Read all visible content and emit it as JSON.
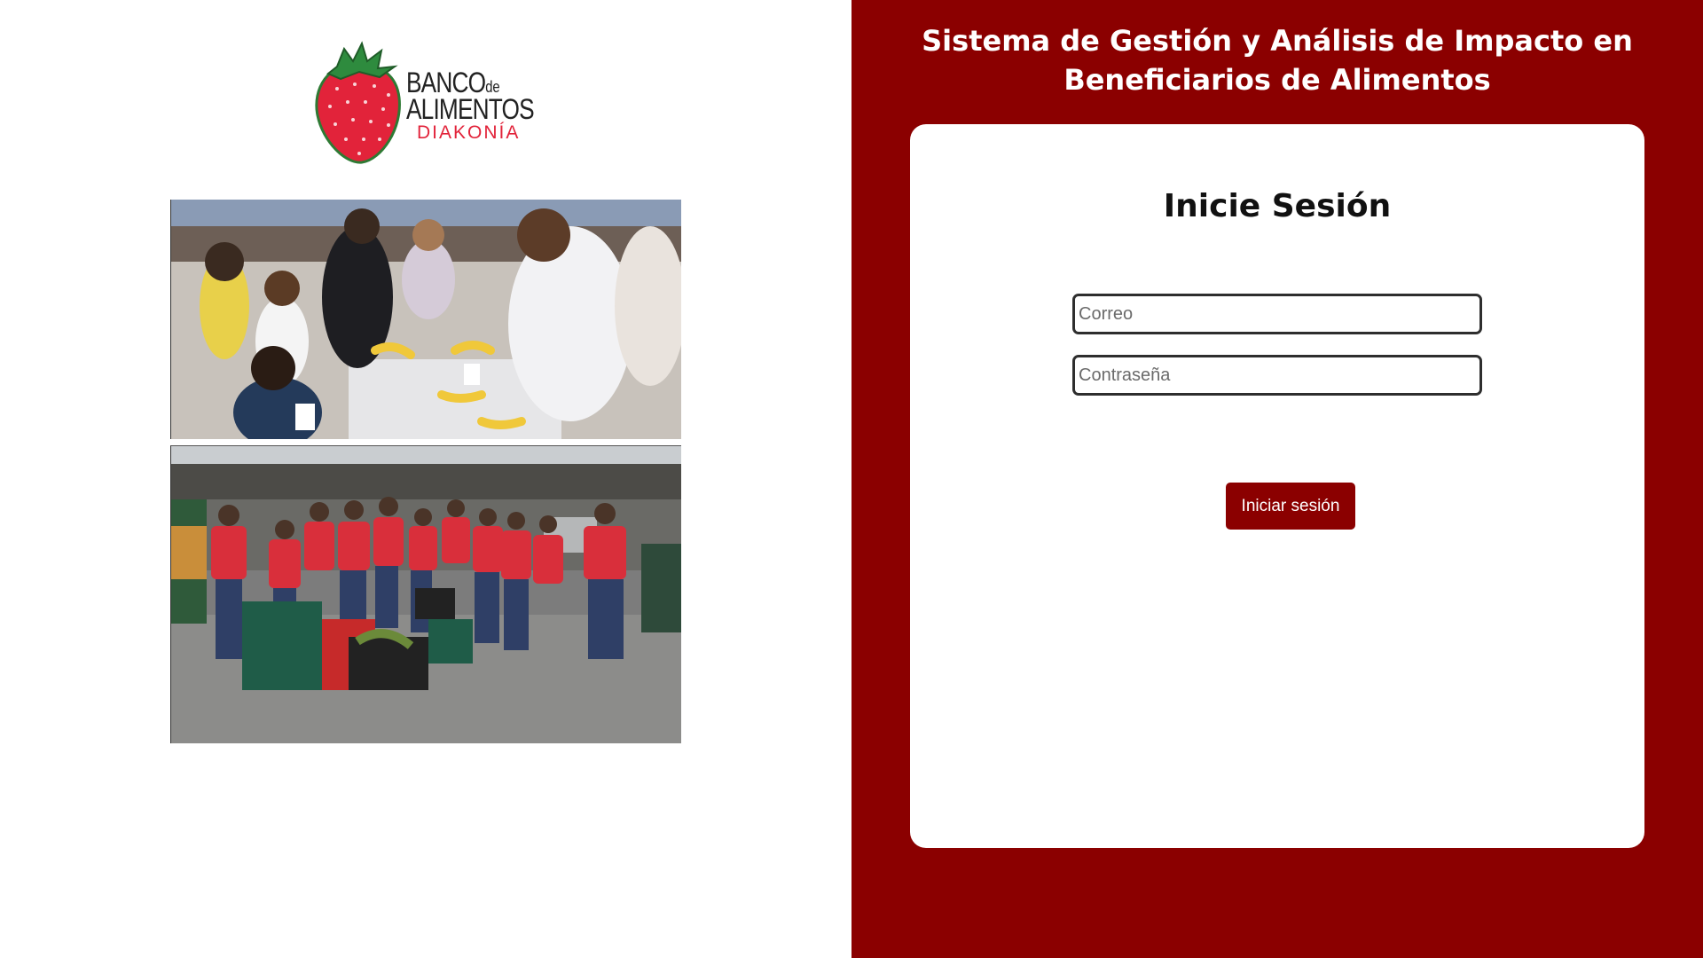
{
  "brand": {
    "logo_line1": "BANCO",
    "logo_line1_small": "de",
    "logo_line2": "ALIMENTOS",
    "logo_line3": "DIAKONÍA",
    "strawberry_color": "#e2233a",
    "leaf_color": "#2e8b3e"
  },
  "header": {
    "title": "Sistema de Gestión y Análisis de Impacto en Beneficiarios de Alimentos"
  },
  "login": {
    "title": "Inicie Sesión",
    "email_placeholder": "Correo",
    "password_placeholder": "Contraseña",
    "submit_label": "Iniciar sesión"
  },
  "theme": {
    "primary": "#8b0000",
    "card_bg": "#ffffff"
  }
}
